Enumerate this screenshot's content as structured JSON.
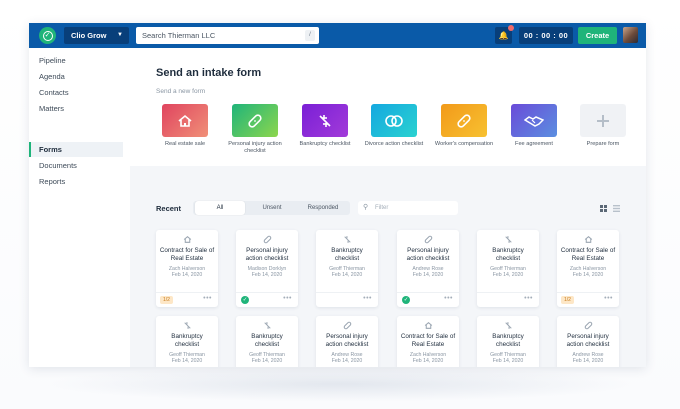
{
  "topbar": {
    "app_name": "Clio Grow",
    "search_placeholder": "Search Thierman LLC",
    "search_shortcut": "/",
    "timer": "00 : 00 : 00",
    "create_label": "Create"
  },
  "sidebar": {
    "items": [
      {
        "label": "Pipeline"
      },
      {
        "label": "Agenda"
      },
      {
        "label": "Contacts"
      },
      {
        "label": "Matters"
      },
      {
        "label": "Forms"
      },
      {
        "label": "Documents"
      },
      {
        "label": "Reports"
      }
    ],
    "active": "Forms"
  },
  "intake": {
    "title": "Send an intake form",
    "subtitle": "Send a new form",
    "tiles": [
      {
        "label": "Real estate sale",
        "color": "#e0445f",
        "color2": "#f09078",
        "icon": "house-icon"
      },
      {
        "label": "Personal injury action checklist",
        "color": "#1fb47a",
        "color2": "#8dd64d",
        "icon": "bandage-icon"
      },
      {
        "label": "Bankruptcy checklist",
        "color": "#7a1fd6",
        "color2": "#a23bd9",
        "icon": "broken-dollar-icon"
      },
      {
        "label": "Divorce action checklist",
        "color": "#14a8e0",
        "color2": "#2ad2d0",
        "icon": "rings-icon"
      },
      {
        "label": "Worker's compensation",
        "color": "#f29a1a",
        "color2": "#f7c131",
        "icon": "bandage-icon"
      },
      {
        "label": "Fee agreement",
        "color": "#6a4bd9",
        "color2": "#5b8fe0",
        "icon": "handshake-icon"
      },
      {
        "label": "Prepare form",
        "color": "#f0f2f5",
        "color2": "#f0f2f5",
        "icon": "plus-icon"
      }
    ]
  },
  "recent": {
    "label": "Recent",
    "tabs": [
      {
        "label": "All"
      },
      {
        "label": "Unsent"
      },
      {
        "label": "Responded"
      }
    ],
    "active_tab": "All",
    "filter_placeholder": "Filter",
    "cards": [
      {
        "icon": "house-icon",
        "title": "Contract for Sale of Real Estate",
        "name": "Zach Halverson",
        "date": "Feb 14, 2020",
        "status": "1/2"
      },
      {
        "icon": "bandage-icon",
        "title": "Personal injury action checklist",
        "name": "Madison Dorklyn",
        "date": "Feb 14, 2020",
        "status": "done"
      },
      {
        "icon": "broken-dollar-icon",
        "title": "Bankruptcy checklist",
        "name": "Geoff Thierman",
        "date": "Feb 14, 2020",
        "status": ""
      },
      {
        "icon": "bandage-icon",
        "title": "Personal injury action checklist",
        "name": "Andrew Rose",
        "date": "Feb 14, 2020",
        "status": "done"
      },
      {
        "icon": "broken-dollar-icon",
        "title": "Bankruptcy checklist",
        "name": "Geoff Thierman",
        "date": "Feb 14, 2020",
        "status": ""
      },
      {
        "icon": "house-icon",
        "title": "Contract for Sale of Real Estate",
        "name": "Zach Halverson",
        "date": "Feb 14, 2020",
        "status": "1/2"
      },
      {
        "icon": "broken-dollar-icon",
        "title": "Bankruptcy checklist",
        "name": "Geoff Thierman",
        "date": "Feb 14, 2020",
        "status": ""
      },
      {
        "icon": "broken-dollar-icon",
        "title": "Bankruptcy checklist",
        "name": "Geoff Thierman",
        "date": "Feb 14, 2020",
        "status": ""
      },
      {
        "icon": "bandage-icon",
        "title": "Personal injury action checklist",
        "name": "Andrew Rose",
        "date": "Feb 14, 2020",
        "status": "done"
      },
      {
        "icon": "house-icon",
        "title": "Contract for Sale of Real Estate",
        "name": "Zach Halverson",
        "date": "Feb 14, 2020",
        "status": "1/2"
      },
      {
        "icon": "broken-dollar-icon",
        "title": "Bankruptcy checklist",
        "name": "Geoff Thierman",
        "date": "Feb 14, 2020",
        "status": ""
      },
      {
        "icon": "bandage-icon",
        "title": "Personal injury action checklist",
        "name": "Andrew Rose",
        "date": "Feb 14, 2020",
        "status": "done"
      }
    ]
  }
}
